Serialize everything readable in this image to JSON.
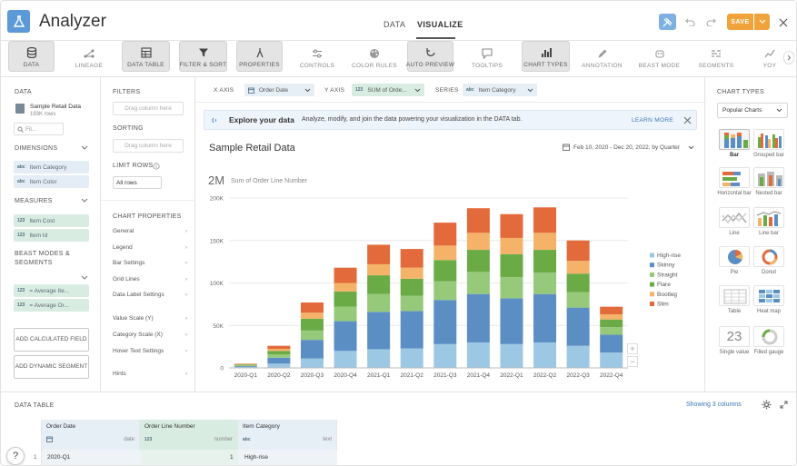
{
  "header": {
    "title": "Analyzer",
    "tabs": [
      "DATA",
      "VISUALIZE"
    ],
    "active_tab": "VISUALIZE",
    "save_label": "SAVE",
    "accent": "#f0a33a"
  },
  "toolbar": {
    "tools": [
      {
        "label": "DATA",
        "icon": "database-icon",
        "active": true
      },
      {
        "label": "LINEAGE",
        "icon": "lineage-icon",
        "active": false
      },
      {
        "label": "DATA TABLE",
        "icon": "table-icon",
        "active": true
      },
      {
        "label": "FILTER & SORT",
        "icon": "filter-icon",
        "active": true
      },
      {
        "label": "PROPERTIES",
        "icon": "properties-icon",
        "active": true
      },
      {
        "label": "CONTROLS",
        "icon": "sliders-icon",
        "active": false
      },
      {
        "label": "COLOR RULES",
        "icon": "palette-icon",
        "active": false
      },
      {
        "label": "AUTO PREVIEW",
        "icon": "refresh-icon",
        "active": true
      },
      {
        "label": "TOOLTIPS",
        "icon": "tooltip-icon",
        "active": false
      },
      {
        "label": "CHART TYPES",
        "icon": "bar-chart-icon",
        "active": true
      },
      {
        "label": "ANNOTATION",
        "icon": "pencil-icon",
        "active": false
      },
      {
        "label": "BEAST MODE",
        "icon": "beast-icon",
        "active": false
      },
      {
        "label": "SEGMENTS",
        "icon": "segments-icon",
        "active": false
      },
      {
        "label": "YOY",
        "icon": "yoy-icon",
        "active": false
      }
    ]
  },
  "data_panel": {
    "title": "DATA",
    "dataset_name": "Sample Retail Data",
    "dataset_rows": "193K rows",
    "filter_placeholder": "Fil...",
    "dimensions_label": "DIMENSIONS",
    "dimensions": [
      {
        "type": "abc",
        "name": "Item Category"
      },
      {
        "type": "abc",
        "name": "Item Color"
      }
    ],
    "measures_label": "MEASURES",
    "measures": [
      {
        "type": "123",
        "name": "Item Cost"
      },
      {
        "type": "123",
        "name": "Item Id"
      }
    ],
    "beast_label": "BEAST MODES & SEGMENTS",
    "beast_modes": [
      {
        "type": "123",
        "name": "= Average Ite..."
      },
      {
        "type": "123",
        "name": "= Average Or..."
      }
    ],
    "add_calc_label": "ADD CALCULATED FIELD",
    "add_segment_label": "ADD DYNAMIC SEGMENT"
  },
  "filters_panel": {
    "filters_label": "FILTERS",
    "filters_drop": "Drag column here",
    "sorting_label": "SORTING",
    "sorting_drop": "Drag column here",
    "limit_label": "LIMIT ROWS",
    "limit_value": "All rows",
    "props_label": "CHART PROPERTIES",
    "props": [
      "General",
      "Legend",
      "Bar Settings",
      "Grid Lines",
      "Data Label Settings",
      "Value Scale (Y)",
      "Category Scale (X)",
      "Hover Text Settings",
      "Hints"
    ]
  },
  "axes_bar": {
    "x_label": "X AXIS",
    "x_value": "Order Date",
    "y_label": "Y AXIS",
    "y_value": "SUM of Orde...",
    "series_label": "SERIES",
    "series_value": "Item Category"
  },
  "banner": {
    "title": "Explore your data",
    "text": "Analyze, modify, and join the data powering your visualization in the DATA tab.",
    "link": "LEARN MORE"
  },
  "chart_header": {
    "title": "Sample Retail Data",
    "date_range": "Feb 10, 2020 - Dec 20, 2022, by Quarter",
    "summary_value": "2M",
    "summary_label": "Sum of Order Line Number"
  },
  "chart_data": {
    "type": "bar",
    "stacked": true,
    "categories": [
      "2020-Q1",
      "2020-Q2",
      "2020-Q3",
      "2020-Q4",
      "2021-Q1",
      "2021-Q2",
      "2021-Q3",
      "2021-Q4",
      "2022-Q1",
      "2022-Q2",
      "2022-Q3",
      "2022-Q4"
    ],
    "ylim": [
      0,
      200000
    ],
    "yticks": [
      0,
      50000,
      100000,
      150000,
      200000
    ],
    "ytick_labels": [
      "0",
      "50K",
      "100K",
      "150K",
      "200K"
    ],
    "legend_position": "right",
    "grid": true,
    "series": [
      {
        "name": "High-rise",
        "color": "#9dc8e4",
        "values": [
          1000,
          5000,
          11000,
          20000,
          22000,
          23000,
          28000,
          30000,
          28000,
          30000,
          26000,
          18000
        ]
      },
      {
        "name": "Skinny",
        "color": "#5b8fc3",
        "values": [
          1000,
          7000,
          22000,
          35000,
          44000,
          44000,
          52000,
          57000,
          54000,
          57000,
          45000,
          21000
        ]
      },
      {
        "name": "Straight",
        "color": "#97c97b",
        "values": [
          1000,
          4000,
          11000,
          17000,
          21000,
          18000,
          22000,
          26000,
          25000,
          25000,
          18000,
          9000
        ]
      },
      {
        "name": "Flare",
        "color": "#6aab46",
        "values": [
          1000,
          4000,
          14000,
          18000,
          22000,
          20000,
          25000,
          26000,
          27000,
          27000,
          22000,
          9000
        ]
      },
      {
        "name": "Bootleg",
        "color": "#f5b36a",
        "values": [
          500,
          2500,
          7000,
          10000,
          13000,
          13000,
          17000,
          20000,
          19000,
          20000,
          15000,
          6000
        ]
      },
      {
        "name": "Slim",
        "color": "#e36a3a",
        "values": [
          500,
          3500,
          12000,
          18000,
          23000,
          22000,
          27000,
          29000,
          28000,
          30000,
          24000,
          9000
        ]
      }
    ]
  },
  "chart_types": {
    "title": "CHART TYPES",
    "filter_value": "Popular Charts",
    "items": [
      {
        "label": "Bar",
        "icon": "bar-icon"
      },
      {
        "label": "Grouped bar",
        "icon": "grouped-bar-icon"
      },
      {
        "label": "Horizontal bar",
        "icon": "horizontal-bar-icon"
      },
      {
        "label": "Nested bar",
        "icon": "nested-bar-icon"
      },
      {
        "label": "Line",
        "icon": "line-icon"
      },
      {
        "label": "Line bar",
        "icon": "line-bar-icon"
      },
      {
        "label": "Pie",
        "icon": "pie-icon"
      },
      {
        "label": "Donut",
        "icon": "donut-icon"
      },
      {
        "label": "Table",
        "icon": "table-icon"
      },
      {
        "label": "Heat map",
        "icon": "heat-map-icon"
      },
      {
        "label": "Single value",
        "icon": "single-value-icon"
      },
      {
        "label": "Filled gauge",
        "icon": "gauge-icon"
      }
    ],
    "single_value_text": "23"
  },
  "data_table": {
    "title": "DATA TABLE",
    "showing": "Showing 3 columns",
    "columns": [
      {
        "name": "Order Date",
        "type": "date"
      },
      {
        "name": "Order Line Number",
        "type": "number",
        "type_icon": "123"
      },
      {
        "name": "Item Category",
        "type": "text",
        "type_icon": "abc"
      }
    ],
    "rows": [
      {
        "num": "1",
        "cells": [
          "2020-Q1",
          "1",
          "High-rise"
        ]
      }
    ]
  }
}
